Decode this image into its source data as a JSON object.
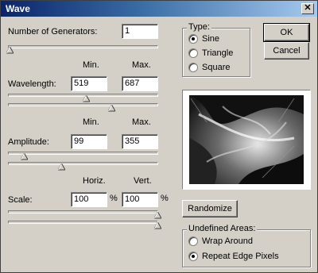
{
  "window": {
    "title": "Wave",
    "close_glyph": "✕"
  },
  "generators": {
    "label": "Number of Generators:",
    "value": "1",
    "slider_fraction": 0.0
  },
  "wavelength": {
    "min_header": "Min.",
    "max_header": "Max.",
    "label": "Wavelength:",
    "min": "519",
    "max": "687",
    "min_slider_fraction": 0.52,
    "max_slider_fraction": 0.69
  },
  "amplitude": {
    "min_header": "Min.",
    "max_header": "Max.",
    "label": "Amplitude:",
    "min": "99",
    "max": "355",
    "min_slider_fraction": 0.1,
    "max_slider_fraction": 0.35
  },
  "scale": {
    "horiz_header": "Horiz.",
    "vert_header": "Vert.",
    "label": "Scale:",
    "horiz": "100",
    "vert": "100",
    "unit": "%",
    "horiz_slider_fraction": 1.0,
    "vert_slider_fraction": 1.0
  },
  "type_group": {
    "title": "Type:",
    "options": [
      "Sine",
      "Triangle",
      "Square"
    ],
    "selected": "Sine"
  },
  "buttons": {
    "ok": "OK",
    "cancel": "Cancel",
    "randomize": "Randomize"
  },
  "undefined_areas": {
    "title": "Undefined Areas:",
    "options": [
      "Wrap Around",
      "Repeat Edge Pixels"
    ],
    "selected": "Repeat Edge Pixels"
  },
  "colors": {
    "dialog_bg": "#d4d0c8",
    "title_start": "#0a246a",
    "title_end": "#a6caf0"
  }
}
